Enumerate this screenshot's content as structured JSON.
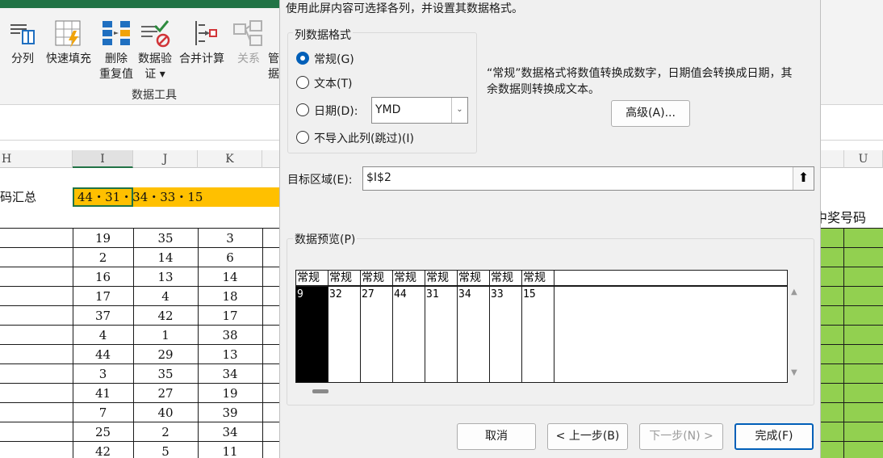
{
  "ribbon": {
    "tools": [
      {
        "label1": "分列",
        "label2": "",
        "icon": "text-to-columns-icon"
      },
      {
        "label1": "快速填充",
        "label2": "",
        "icon": "flash-fill-icon"
      },
      {
        "label1": "删除",
        "label2": "重复值",
        "icon": "remove-duplicates-icon"
      },
      {
        "label1": "数据验",
        "label2": "证 ▾",
        "icon": "data-validation-icon"
      },
      {
        "label1": "合并计算",
        "label2": "",
        "icon": "consolidate-icon"
      },
      {
        "label1": "关系",
        "label2": "",
        "icon": "relationships-icon"
      },
      {
        "label1": "管",
        "label2": "据",
        "icon": "manage-data-model-icon"
      }
    ],
    "group_label": "数据工具"
  },
  "sheet": {
    "columns": [
      "H",
      "I",
      "J",
      "K",
      "U"
    ],
    "summary_label": "码汇总",
    "selected_cell_value": "44・31・34・33・15",
    "prize_header": "中奖号码",
    "rows": [
      [
        "19",
        "35",
        "3"
      ],
      [
        "2",
        "14",
        "6"
      ],
      [
        "16",
        "13",
        "14"
      ],
      [
        "17",
        "4",
        "18"
      ],
      [
        "37",
        "42",
        "17"
      ],
      [
        "4",
        "1",
        "38"
      ],
      [
        "44",
        "29",
        "13"
      ],
      [
        "3",
        "35",
        "34"
      ],
      [
        "41",
        "27",
        "19"
      ],
      [
        "7",
        "40",
        "39"
      ],
      [
        "25",
        "2",
        "34"
      ],
      [
        "42",
        "5",
        "11"
      ]
    ]
  },
  "dialog": {
    "intro": "使用此屏内容可选择各列，并设置其数据格式。",
    "format_group_title": "列数据格式",
    "radio_general": "常规(G)",
    "radio_text": "文本(T)",
    "radio_date": "日期(D):",
    "radio_skip": "不导入此列(跳过)(I)",
    "selected_format": "常规(G)",
    "date_format_value": "YMD",
    "description_line1": "“常规”数据格式将数值转换成数字，日期值会转换成日期，其",
    "description_line2": "余数据则转换成文本。",
    "advanced_button": "高级(A)...",
    "destination_label": "目标区域(E):",
    "destination_value": "$I$2",
    "preview_label": "数据预览(P)",
    "preview_headers": [
      "常规",
      "常规",
      "常规",
      "常规",
      "常规",
      "常规",
      "常规",
      "常规"
    ],
    "preview_values": [
      "9",
      "32",
      "27",
      "44",
      "31",
      "34",
      "33",
      "15"
    ],
    "cancel_button": "取消",
    "back_button": "< 上一步(B)",
    "next_button": "下一步(N) >",
    "finish_button": "完成(F)"
  },
  "colors": {
    "accent": "#005fb8",
    "highlight_cell": "#ffc000",
    "green_cells": "#92d050"
  }
}
